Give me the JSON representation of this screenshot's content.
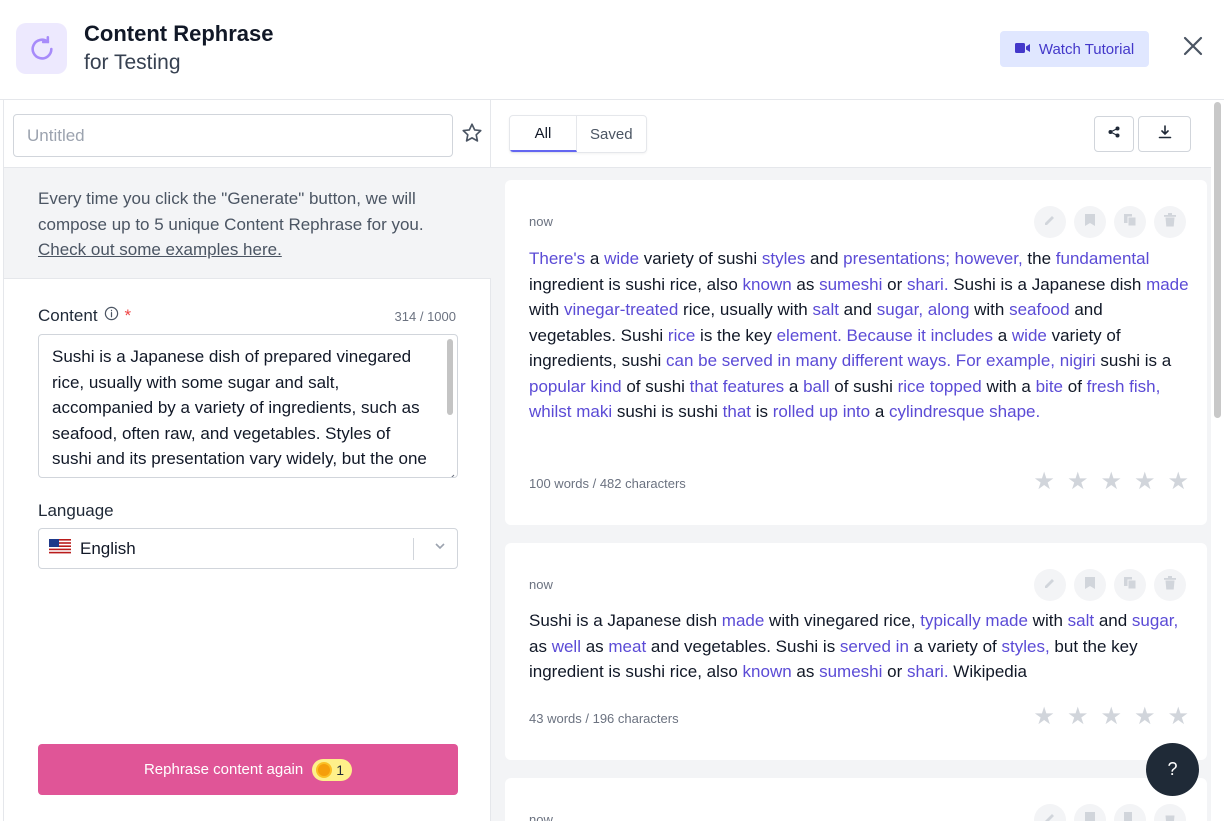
{
  "header": {
    "title": "Content Rephrase",
    "subtitle": "for Testing",
    "tutorial_label": "Watch Tutorial"
  },
  "left": {
    "title_placeholder": "Untitled",
    "info_text": "Every time you click the \"Generate\" button, we will compose up to 5 unique Content Rephrase for you. ",
    "info_link": "Check out some examples here.",
    "content_label": "Content",
    "required_mark": "*",
    "char_count": "314 / 1000",
    "content_value": "Sushi is a Japanese dish of prepared vinegared rice, usually with some sugar and salt, accompanied by a variety of ingredients, such as seafood, often raw, and vegetables. Styles of sushi and its presentation vary widely, but the one key ingredient is \"sushi rice\", also referred to as shari or sumeshi.",
    "language_label": "Language",
    "language_value": "English",
    "rephrase_label": "Rephrase content again",
    "credit_count": "1"
  },
  "right": {
    "tabs": [
      {
        "label": "All"
      },
      {
        "label": "Saved"
      }
    ],
    "cards": [
      {
        "time": "now",
        "meta": "100 words / 482 characters",
        "segments": [
          {
            "t": "There's",
            "h": true
          },
          {
            "t": " a "
          },
          {
            "t": "wide",
            "h": true
          },
          {
            "t": " variety of sushi "
          },
          {
            "t": "styles",
            "h": true
          },
          {
            "t": " and "
          },
          {
            "t": "presentations; however,",
            "h": true
          },
          {
            "t": " the "
          },
          {
            "t": "fundamental",
            "h": true
          },
          {
            "t": " ingredient is sushi rice, also "
          },
          {
            "t": "known",
            "h": true
          },
          {
            "t": " as "
          },
          {
            "t": "sumeshi",
            "h": true
          },
          {
            "t": " or "
          },
          {
            "t": "shari.",
            "h": true
          },
          {
            "t": " Sushi is a Japanese dish "
          },
          {
            "t": "made",
            "h": true
          },
          {
            "t": " with "
          },
          {
            "t": "vinegar-treated",
            "h": true
          },
          {
            "t": " rice, usually with "
          },
          {
            "t": "salt",
            "h": true
          },
          {
            "t": " and "
          },
          {
            "t": "sugar, along",
            "h": true
          },
          {
            "t": " with "
          },
          {
            "t": "seafood",
            "h": true
          },
          {
            "t": " and vegetables. Sushi "
          },
          {
            "t": "rice",
            "h": true
          },
          {
            "t": " is the key "
          },
          {
            "t": "element. Because it includes",
            "h": true
          },
          {
            "t": " a "
          },
          {
            "t": "wide",
            "h": true
          },
          {
            "t": " variety of ingredients, sushi "
          },
          {
            "t": "can be served in many different ways. For example, nigiri",
            "h": true
          },
          {
            "t": " sushi is a "
          },
          {
            "t": "popular kind",
            "h": true
          },
          {
            "t": " of sushi "
          },
          {
            "t": "that features",
            "h": true
          },
          {
            "t": " a "
          },
          {
            "t": "ball",
            "h": true
          },
          {
            "t": " of sushi "
          },
          {
            "t": "rice topped",
            "h": true
          },
          {
            "t": " with a "
          },
          {
            "t": "bite",
            "h": true
          },
          {
            "t": " of "
          },
          {
            "t": "fresh fish, whilst maki",
            "h": true
          },
          {
            "t": " sushi is sushi "
          },
          {
            "t": "that",
            "h": true
          },
          {
            "t": " is "
          },
          {
            "t": "rolled up into",
            "h": true
          },
          {
            "t": " a "
          },
          {
            "t": "cylindresque shape.",
            "h": true
          }
        ]
      },
      {
        "time": "now",
        "meta": "43 words / 196 characters",
        "segments": [
          {
            "t": "Sushi is a Japanese dish "
          },
          {
            "t": "made",
            "h": true
          },
          {
            "t": " with vinegared rice, "
          },
          {
            "t": "typically made",
            "h": true
          },
          {
            "t": " with "
          },
          {
            "t": "salt",
            "h": true
          },
          {
            "t": " and "
          },
          {
            "t": "sugar,",
            "h": true
          },
          {
            "t": " as "
          },
          {
            "t": "well",
            "h": true
          },
          {
            "t": " as "
          },
          {
            "t": "meat",
            "h": true
          },
          {
            "t": " and vegetables. Sushi is "
          },
          {
            "t": "served in",
            "h": true
          },
          {
            "t": " a variety of "
          },
          {
            "t": "styles,",
            "h": true
          },
          {
            "t": " but the key ingredient is sushi rice, also "
          },
          {
            "t": "known",
            "h": true
          },
          {
            "t": " as "
          },
          {
            "t": "sumeshi",
            "h": true
          },
          {
            "t": " or "
          },
          {
            "t": "shari.",
            "h": true
          },
          {
            "t": " Wikipedia"
          }
        ]
      },
      {
        "time": "now"
      }
    ]
  },
  "help_label": "?",
  "icons": {
    "app": "refresh-icon",
    "tutorial": "video-camera-icon",
    "close": "close-icon",
    "favorite": "star-outline-icon",
    "info": "info-icon",
    "flag": "us-flag-icon",
    "dropdown": "chevron-down-icon",
    "share": "share-icon",
    "download": "download-icon",
    "edit": "pencil-icon",
    "save": "bookmark-icon",
    "copy": "copy-icon",
    "delete": "trash-icon",
    "rating": "star-icon",
    "credit": "coin-icon"
  },
  "colors": {
    "accent": "#6366f1",
    "highlight": "#5b4bd6",
    "rephrase_button": "#e05597",
    "tutorial_bg": "#e0e7ff"
  }
}
